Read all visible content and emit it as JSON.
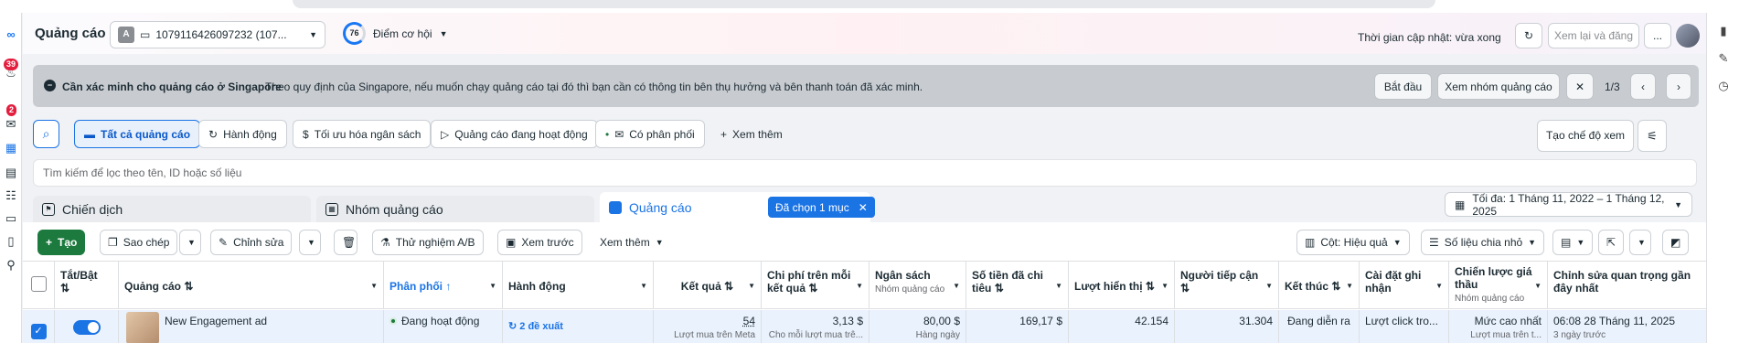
{
  "header": {
    "title": "Quảng cáo",
    "account_badge": "A",
    "account_name": "1079116426097232 (107...",
    "opportunity_score": "76",
    "opportunity_label": "Điểm cơ hội",
    "update_status": "Thời gian cập nhật: vừa xong",
    "review_publish_label": "Xem lại và đăng",
    "more_label": "..."
  },
  "left_rail": {
    "badge_notifications": "39",
    "badge_messages": "2"
  },
  "banner": {
    "title": "Cần xác minh cho quảng cáo ở Singapore",
    "text": "Theo quy định của Singapore, nếu muốn chạy quảng cáo tại đó thì bạn cần có thông tin bên thụ hưởng và bên thanh toán đã xác minh.",
    "start_label": "Bắt đầu",
    "view_adset_label": "Xem nhóm quảng cáo",
    "pagination": "1/3"
  },
  "filters": {
    "tabs": [
      {
        "label": "Tất cả quảng cáo",
        "icon": "folder-icon"
      },
      {
        "label": "Hành động",
        "icon": "action-icon"
      },
      {
        "label": "Tối ưu hóa ngân sách",
        "icon": "budget-icon"
      },
      {
        "label": "Quảng cáo đang hoạt động",
        "icon": "play-icon"
      },
      {
        "label": "Có phân phối",
        "icon": "delivery-icon"
      }
    ],
    "see_more": "Xem thêm",
    "create_view": "Tạo chế độ xem"
  },
  "search": {
    "placeholder": "Tìm kiếm để lọc theo tên, ID hoặc số liệu"
  },
  "levels": {
    "campaign": "Chiến dịch",
    "adset": "Nhóm quảng cáo",
    "ad": "Quảng cáo",
    "selected_chip": "Đã chọn 1 mục",
    "date_range": "Tối đa: 1 Tháng 11, 2022 – 1 Tháng 12, 2025"
  },
  "toolbar": {
    "create": "Tạo",
    "duplicate": "Sao chép",
    "edit": "Chỉnh sửa",
    "ab_test": "Thử nghiệm A/B",
    "preview": "Xem trước",
    "see_more": "Xem thêm",
    "columns": "Cột: Hiệu quả",
    "breakdown": "Số liệu chia nhỏ"
  },
  "table": {
    "headers": {
      "toggle": "Tắt/Bật",
      "ad": "Quảng cáo",
      "delivery": "Phân phối",
      "actions": "Hành động",
      "results": "Kết quả",
      "cost_per_result": "Chi phí trên mỗi kết quả",
      "budget": "Ngân sách",
      "budget_sub": "Nhóm quảng cáo",
      "amount_spent": "Số tiền đã chi tiêu",
      "impressions": "Lượt hiển thị",
      "reach": "Người tiếp cận",
      "ends": "Kết thúc",
      "attribution": "Cài đặt ghi nhận",
      "bid_strategy": "Chiến lược giá thầu",
      "bid_strategy_sub": "Nhóm quảng cáo",
      "last_edit": "Chỉnh sửa quan trọng gần đây nhất"
    },
    "rows": [
      {
        "name": "New Engagement ad",
        "delivery": "Đang hoạt động",
        "actions": "2 đề xuất",
        "results": "54",
        "results_sub": "Lượt mua trên Meta",
        "cost_per_result": "3,13 $",
        "cost_sub": "Cho mỗi lượt mua trê...",
        "budget": "80,00 $",
        "budget_sub": "Hàng ngày",
        "amount_spent": "169,17 $",
        "impressions": "42.154",
        "reach": "31.304",
        "ends": "Đang diễn ra",
        "attribution": "Lượt click tro...",
        "bid_strategy": "Mức cao nhất",
        "bid_sub": "Lượt mua trên t...",
        "last_edit": "06:08 28 Tháng 11, 2025",
        "last_edit_sub": "3 ngày trước"
      }
    ]
  },
  "colors": {
    "brand_blue": "#1b74e4",
    "create_green": "#1c7a3e",
    "badge_red": "#e41e3f"
  }
}
